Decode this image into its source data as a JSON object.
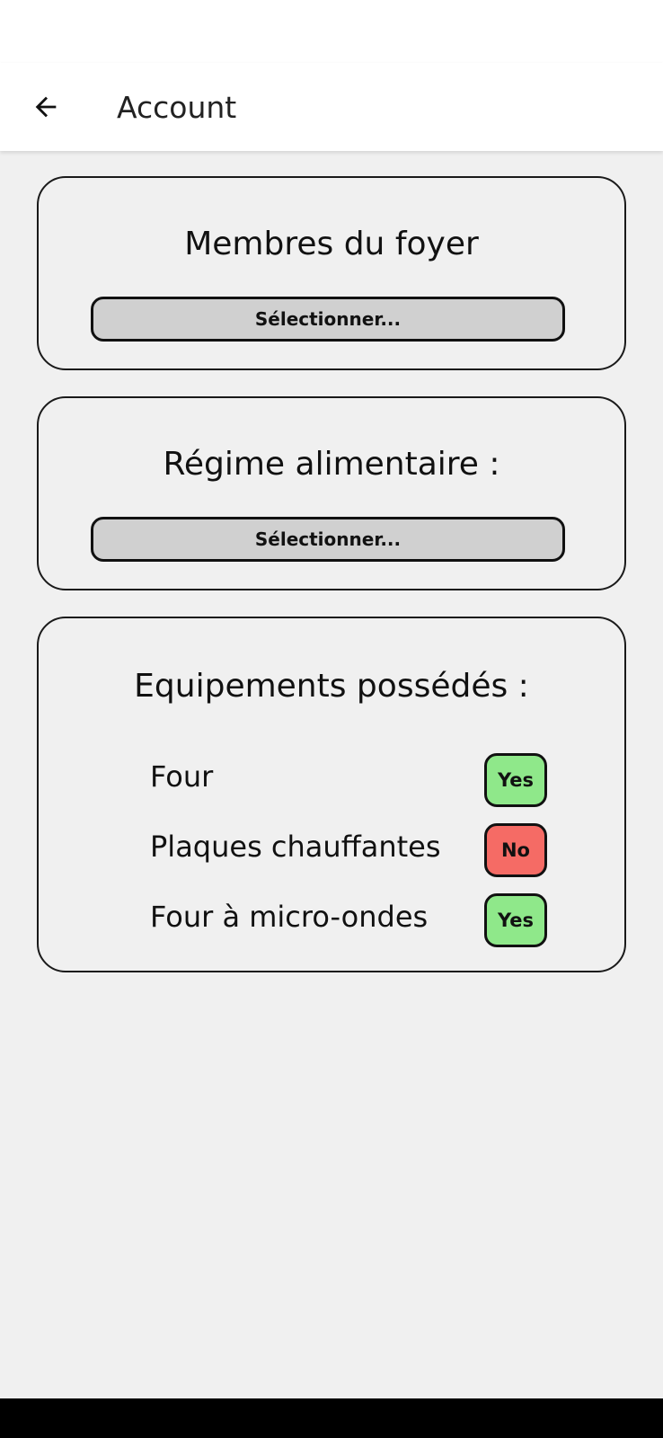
{
  "app_bar": {
    "title": "Account",
    "back_icon": "arrow-left-icon"
  },
  "household": {
    "title": "Membres du foyer",
    "select_label": "Sélectionner..."
  },
  "diet": {
    "title": "Régime alimentaire :",
    "select_label": "Sélectionner..."
  },
  "equipment": {
    "title": "Equipements possédés :",
    "items": [
      {
        "label": "Four",
        "value": "Yes"
      },
      {
        "label": "Plaques chauffantes",
        "value": "No"
      },
      {
        "label": "Four à micro-ondes",
        "value": "Yes"
      }
    ]
  },
  "colors": {
    "yes": "#8fe88a",
    "no": "#f56b65",
    "select_bg": "#d0d0d0",
    "page_bg": "#f0f0f0"
  }
}
